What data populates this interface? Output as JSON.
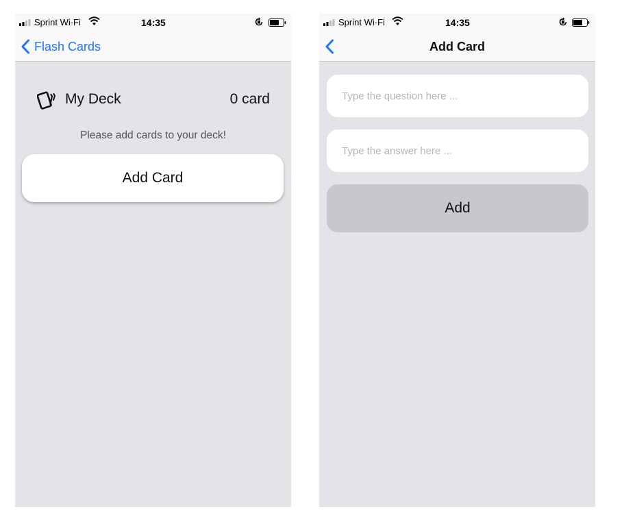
{
  "status_bar": {
    "carrier": "Sprint Wi-Fi",
    "time": "14:35"
  },
  "deck_screen": {
    "back_label": "Flash Cards",
    "deck_title": "My Deck",
    "card_count": "0 card",
    "empty_message": "Please add cards to your deck!",
    "add_card_label": "Add Card"
  },
  "add_card_screen": {
    "title": "Add Card",
    "question_placeholder": "Type the question here ...",
    "answer_placeholder": "Type the answer here ...",
    "question_value": "",
    "answer_value": "",
    "submit_label": "Add"
  },
  "colors": {
    "accent": "#1f75fe",
    "background": "#e3e3e8",
    "nav_background": "#f8f8f8",
    "disabled_button": "#c7c7cc"
  },
  "icons": {
    "deck": "cards-icon",
    "back": "chevron-left-icon",
    "wifi": "wifi-icon",
    "signal": "signal-icon",
    "battery": "battery-icon",
    "rotation_lock": "rotation-lock-icon"
  }
}
